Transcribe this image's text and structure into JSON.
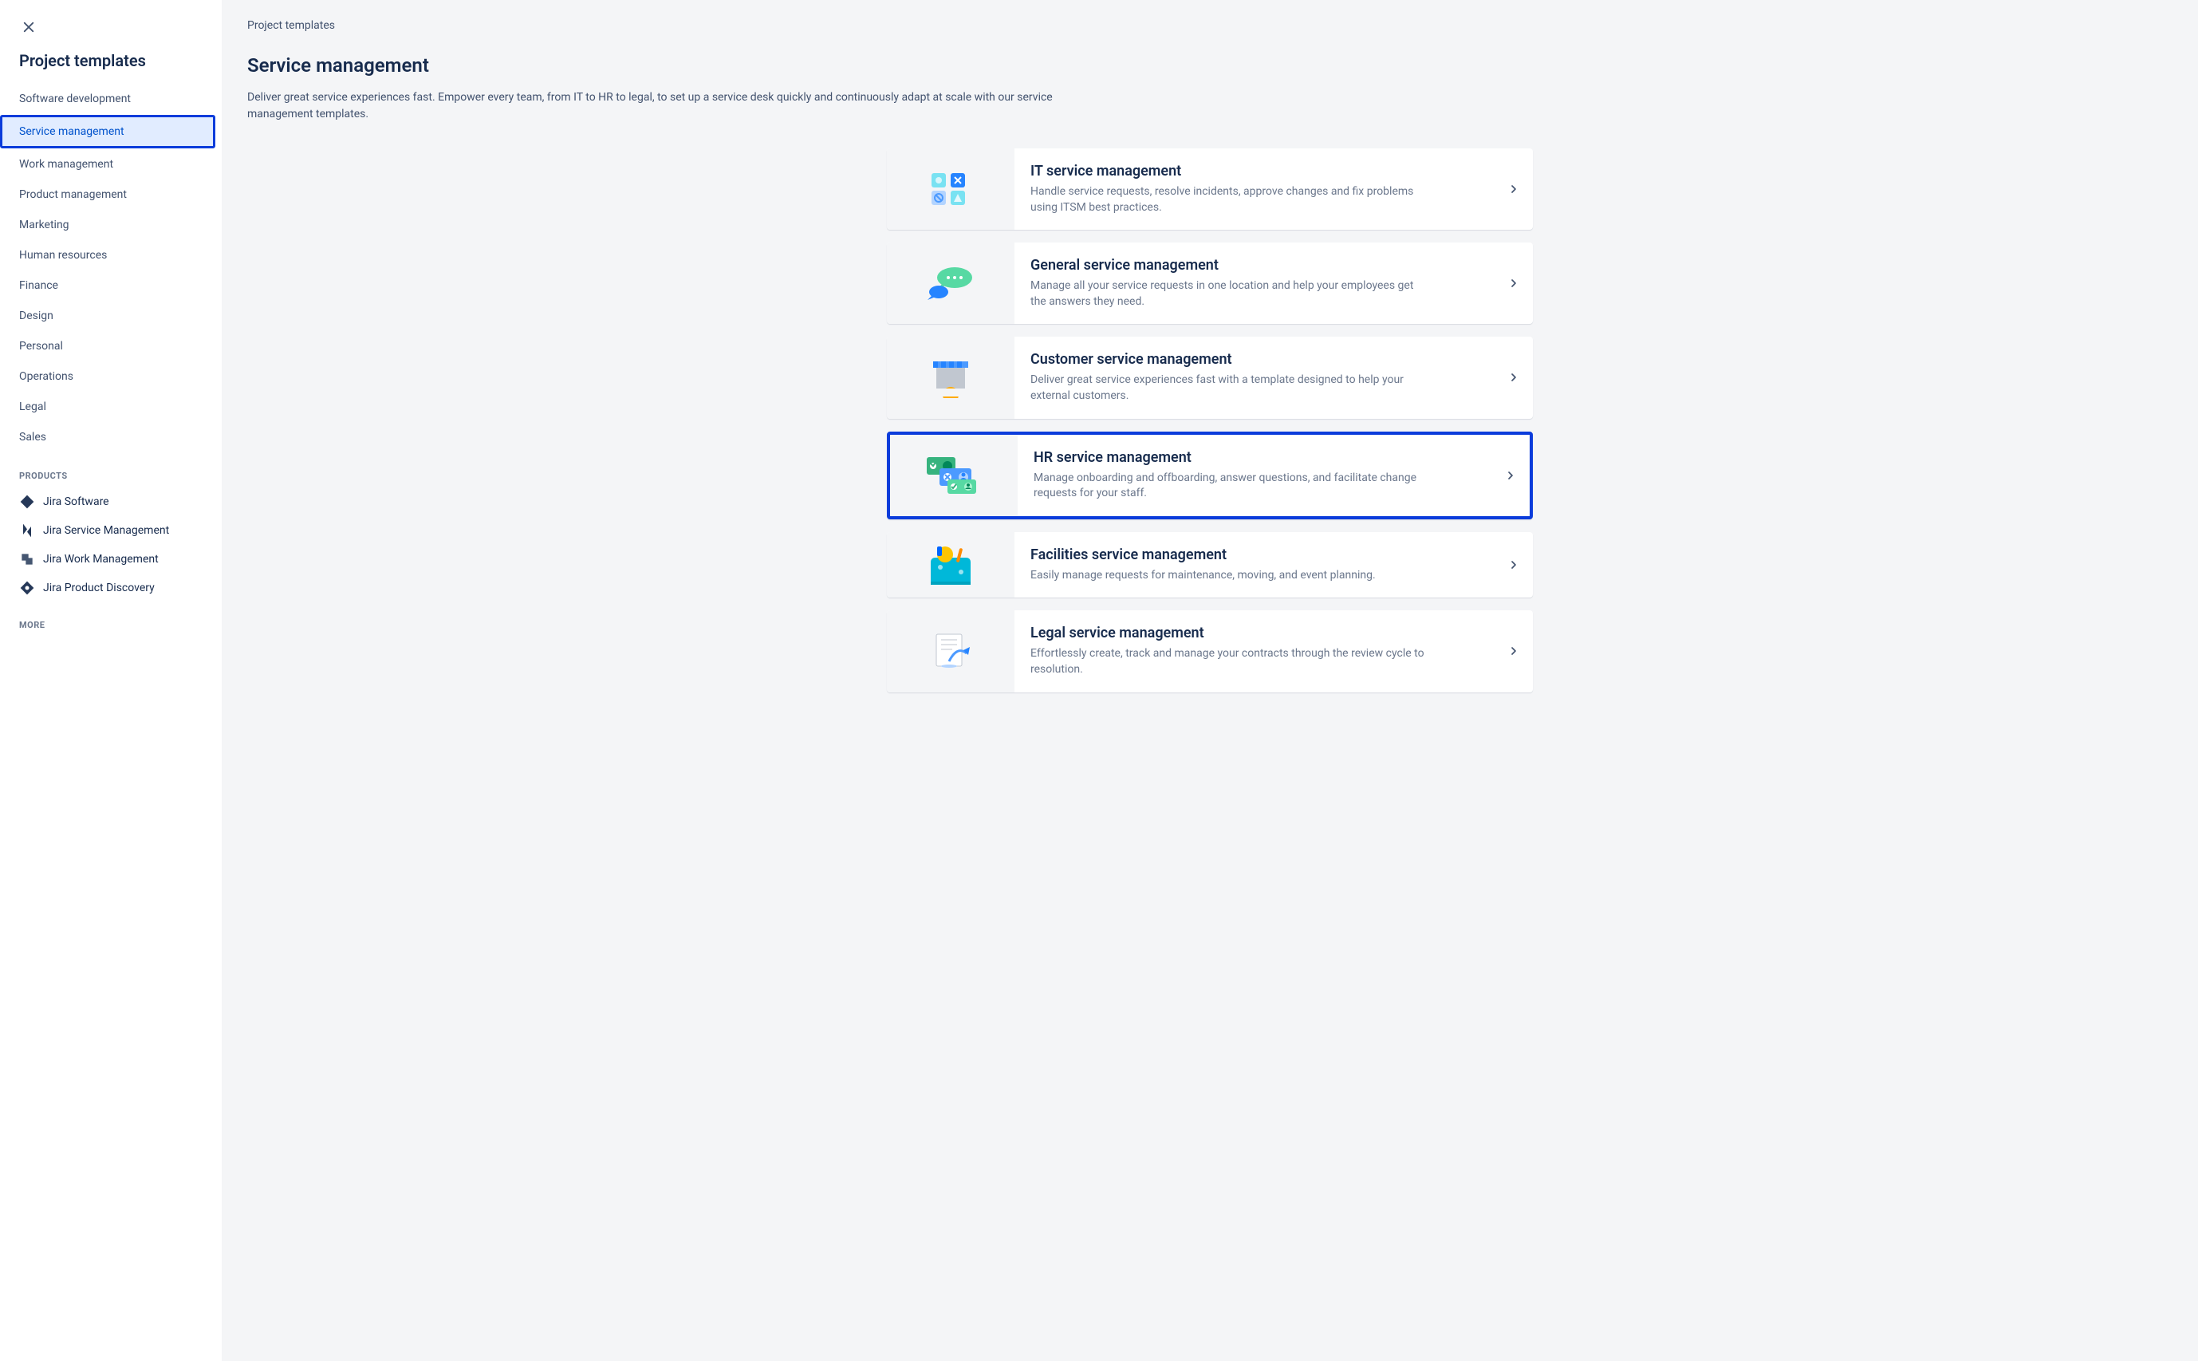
{
  "sidebar": {
    "title": "Project templates",
    "categories": [
      {
        "label": "Software development",
        "selected": false
      },
      {
        "label": "Service management",
        "selected": true
      },
      {
        "label": "Work management",
        "selected": false
      },
      {
        "label": "Product management",
        "selected": false
      },
      {
        "label": "Marketing",
        "selected": false
      },
      {
        "label": "Human resources",
        "selected": false
      },
      {
        "label": "Finance",
        "selected": false
      },
      {
        "label": "Design",
        "selected": false
      },
      {
        "label": "Personal",
        "selected": false
      },
      {
        "label": "Operations",
        "selected": false
      },
      {
        "label": "Legal",
        "selected": false
      },
      {
        "label": "Sales",
        "selected": false
      }
    ],
    "products_label": "PRODUCTS",
    "products": [
      {
        "label": "Jira Software",
        "icon": "jira-software"
      },
      {
        "label": "Jira Service Management",
        "icon": "jira-service"
      },
      {
        "label": "Jira Work Management",
        "icon": "jira-work"
      },
      {
        "label": "Jira Product Discovery",
        "icon": "jira-discovery"
      }
    ],
    "more_label": "MORE"
  },
  "main": {
    "breadcrumb": "Project templates",
    "title": "Service management",
    "description": "Deliver great service experiences fast. Empower every team, from IT to HR to legal, to set up a service desk quickly and continuously adapt at scale with our service management templates.",
    "templates": [
      {
        "title": "IT service management",
        "description": "Handle service requests, resolve incidents, approve changes and fix problems using ITSM best practices.",
        "illus": "itsm",
        "highlighted": false
      },
      {
        "title": "General service management",
        "description": "Manage all your service requests in one location and help your employees get the answers they need.",
        "illus": "general",
        "highlighted": false
      },
      {
        "title": "Customer service management",
        "description": "Deliver great service experiences fast with a template designed to help your external customers.",
        "illus": "customer",
        "highlighted": false
      },
      {
        "title": "HR service management",
        "description": "Manage onboarding and offboarding, answer questions, and facilitate change requests for your staff.",
        "illus": "hr",
        "highlighted": true
      },
      {
        "title": "Facilities service management",
        "description": "Easily manage requests for maintenance, moving, and event planning.",
        "illus": "facilities",
        "highlighted": false
      },
      {
        "title": "Legal service management",
        "description": "Effortlessly create, track and manage your contracts through the review cycle to resolution.",
        "illus": "legal",
        "highlighted": false
      }
    ]
  }
}
